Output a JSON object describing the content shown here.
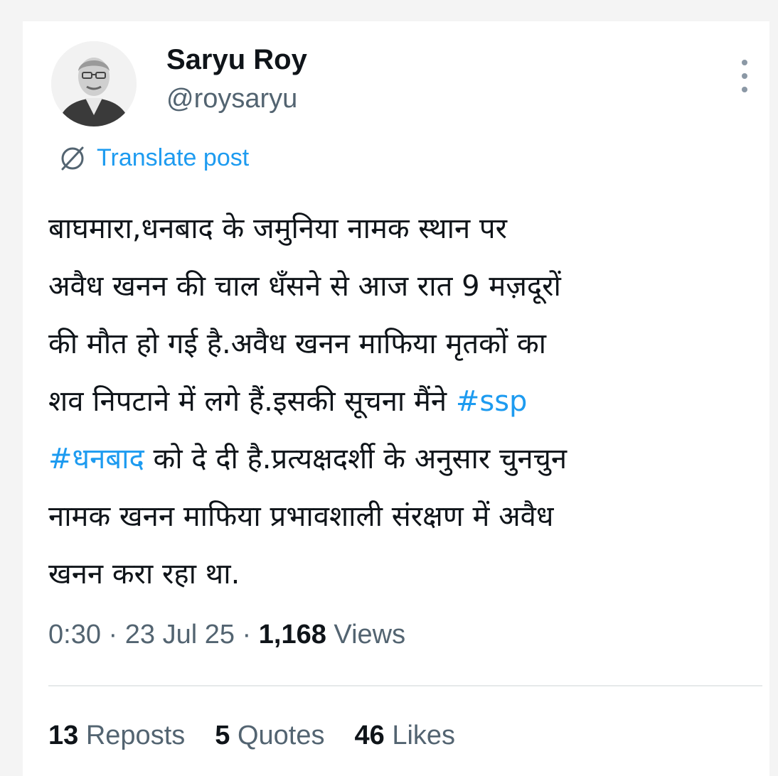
{
  "author": {
    "name": "Saryu Roy",
    "handle": "@roysaryu"
  },
  "translate": {
    "label": "Translate post"
  },
  "tweet": {
    "lines": [
      "बाघमारा,धनबाद के जमुनिया नामक स्थान पर",
      "अवैध खनन की चाल धँसने से आज रात 9 मज़दूरों",
      "की मौत हो गई है.अवैध खनन माफिया मृतकों का"
    ],
    "line4_text": "शव निपटाने में लगे हैं.इसकी सूचना मैंने ",
    "line4_hashtag": "#ssp",
    "line5_hashtag": "#धनबाद",
    "line5_text": " को दे दी है.प्रत्यक्षदर्शी के अनुसार चुनचुन",
    "line6": "नामक खनन माफिया प्रभावशाली संरक्षण में अवैध",
    "line7": "खनन करा रहा था."
  },
  "meta": {
    "time": "0:30",
    "date": "23 Jul 25",
    "views_count": "1,168",
    "views_label": "Views"
  },
  "stats": {
    "reposts_count": "13",
    "reposts_label": "Reposts",
    "quotes_count": "5",
    "quotes_label": "Quotes",
    "likes_count": "46",
    "likes_label": "Likes"
  }
}
